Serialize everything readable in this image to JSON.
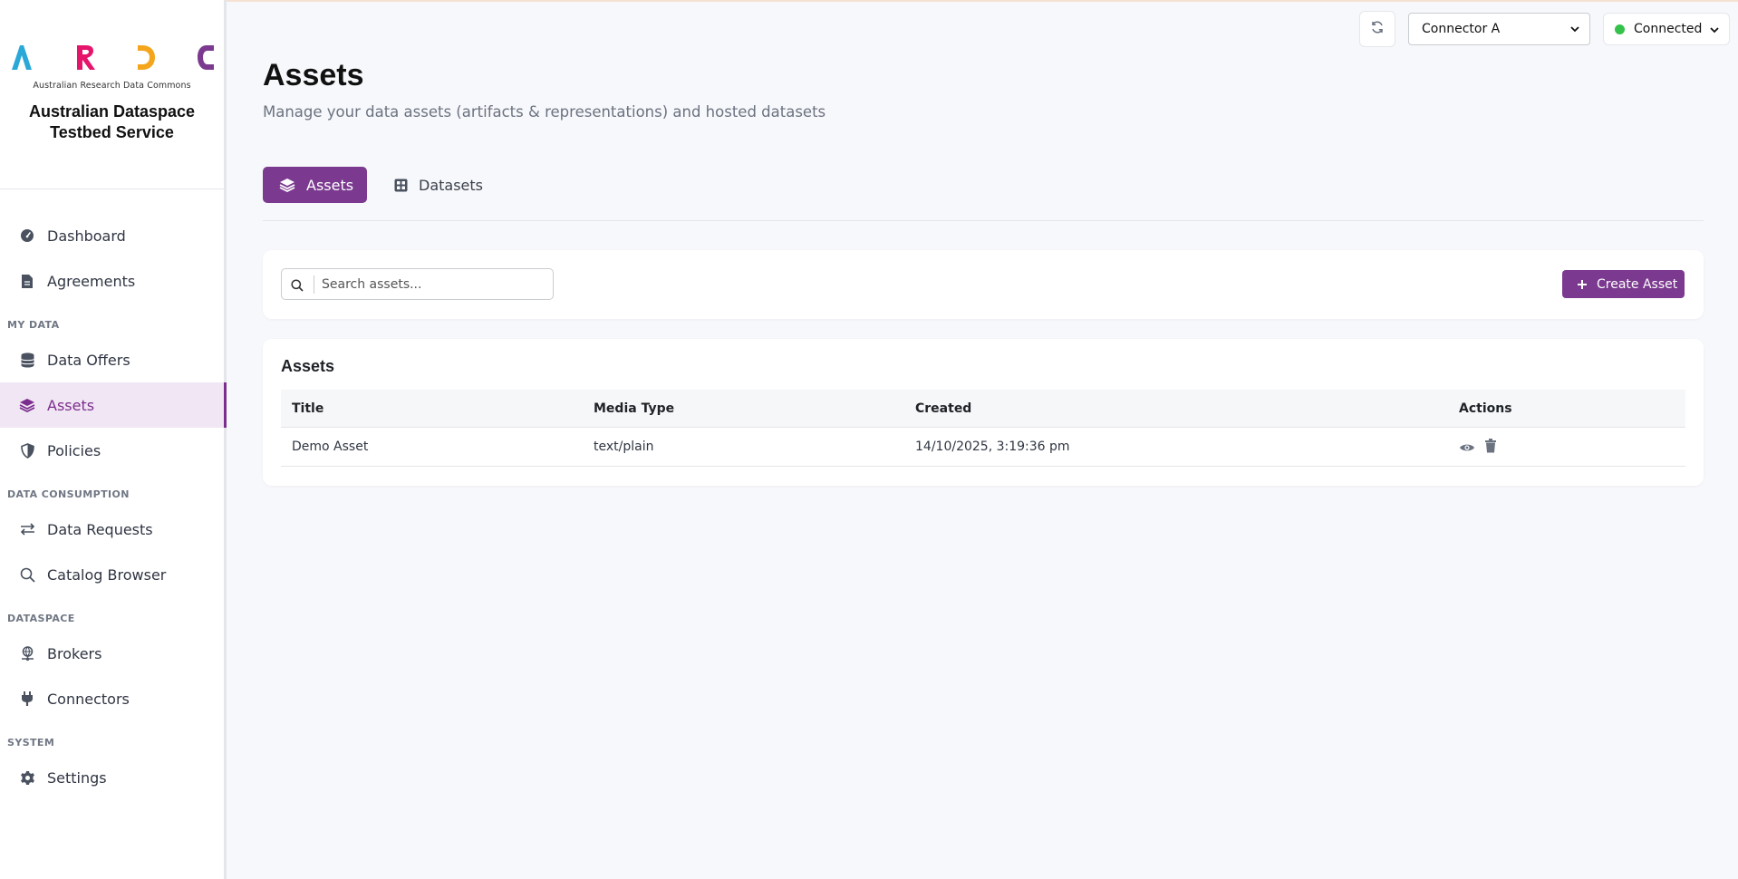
{
  "app": {
    "logo_letters": "ARDC",
    "logo_caption": "Australian Research Data Commons",
    "title": "Australian Dataspace Testbed Service",
    "colors": {
      "accent": "#7b3a8f",
      "logo_a": "#2aa8d8",
      "logo_r": "#e5156b",
      "logo_d": "#f4a51c",
      "logo_c": "#7b3a8f",
      "status_ok": "#35c24a"
    }
  },
  "sidebar": {
    "items": [
      {
        "label": "Dashboard",
        "icon": "gauge-icon"
      },
      {
        "label": "Agreements",
        "icon": "document-icon"
      },
      {
        "section": "MY DATA"
      },
      {
        "label": "Data Offers",
        "icon": "database-icon"
      },
      {
        "label": "Assets",
        "icon": "layers-icon",
        "active": true
      },
      {
        "label": "Policies",
        "icon": "shield-icon"
      },
      {
        "section": "DATA CONSUMPTION"
      },
      {
        "label": "Data Requests",
        "icon": "arrows-exchange-icon"
      },
      {
        "label": "Catalog Browser",
        "icon": "search-icon"
      },
      {
        "section": "DATASPACE"
      },
      {
        "label": "Brokers",
        "icon": "globe-network-icon"
      },
      {
        "label": "Connectors",
        "icon": "plug-icon"
      },
      {
        "section": "SYSTEM"
      },
      {
        "label": "Settings",
        "icon": "gear-icon"
      }
    ]
  },
  "header": {
    "connector_selected": "Connector A",
    "status_label": "Connected"
  },
  "page": {
    "title": "Assets",
    "subtitle": "Manage your data assets (artifacts & representations) and hosted datasets"
  },
  "tabs": [
    {
      "label": "Assets",
      "active": true
    },
    {
      "label": "Datasets",
      "active": false
    }
  ],
  "toolbar": {
    "search_placeholder": "Search assets...",
    "create_label": "Create Asset"
  },
  "table": {
    "title": "Assets",
    "columns": [
      "Title",
      "Media Type",
      "Created",
      "Actions"
    ],
    "rows": [
      {
        "title": "Demo Asset",
        "media_type": "text/plain",
        "created": "14/10/2025, 3:19:36 pm"
      }
    ]
  }
}
